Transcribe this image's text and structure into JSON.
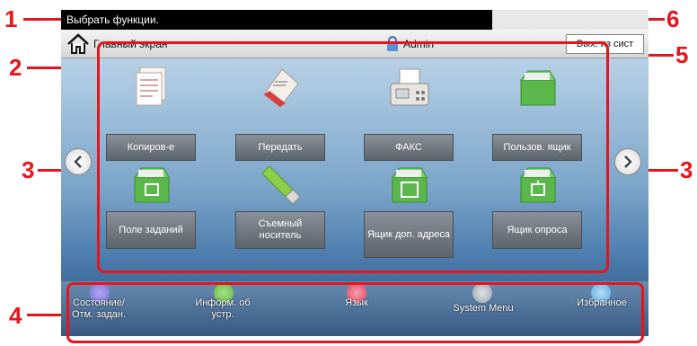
{
  "callouts": {
    "n1": "1",
    "n2": "2",
    "n3a": "3",
    "n3b": "3",
    "n4": "4",
    "n5": "5",
    "n6": "6"
  },
  "topbar": {
    "message": "Выбрать функции."
  },
  "navbar": {
    "home_label": "Главный экран",
    "user": "Admin",
    "logout_label": "Вых. из сист"
  },
  "tiles": [
    {
      "label": "Копиров-е",
      "icon": "copy-icon"
    },
    {
      "label": "Передать",
      "icon": "send-icon"
    },
    {
      "label": "ФАКС",
      "icon": "fax-icon"
    },
    {
      "label": "Пользов. ящик",
      "icon": "custom-box-icon"
    },
    {
      "label": "Поле заданий",
      "icon": "job-box-icon"
    },
    {
      "label": "Съемный носитель",
      "icon": "removable-memory-icon"
    },
    {
      "label": "Ящик доп. адреса",
      "icon": "sub-address-box-icon"
    },
    {
      "label": "Ящик опроса",
      "icon": "polling-box-icon"
    }
  ],
  "bottom": [
    {
      "label": "Состояние/ Отм. задан.",
      "icon": "status-icon",
      "color": "#7b6fd6"
    },
    {
      "label": "Информ. об устр.",
      "icon": "device-info-icon",
      "color": "#5fb83a"
    },
    {
      "label": "Язык",
      "icon": "language-icon",
      "color": "#e0405a"
    },
    {
      "label": "System Menu",
      "icon": "system-menu-icon",
      "color": "#9aa0a8"
    },
    {
      "label": "Избранное",
      "icon": "favorites-icon",
      "color": "#5aa8e0"
    }
  ]
}
